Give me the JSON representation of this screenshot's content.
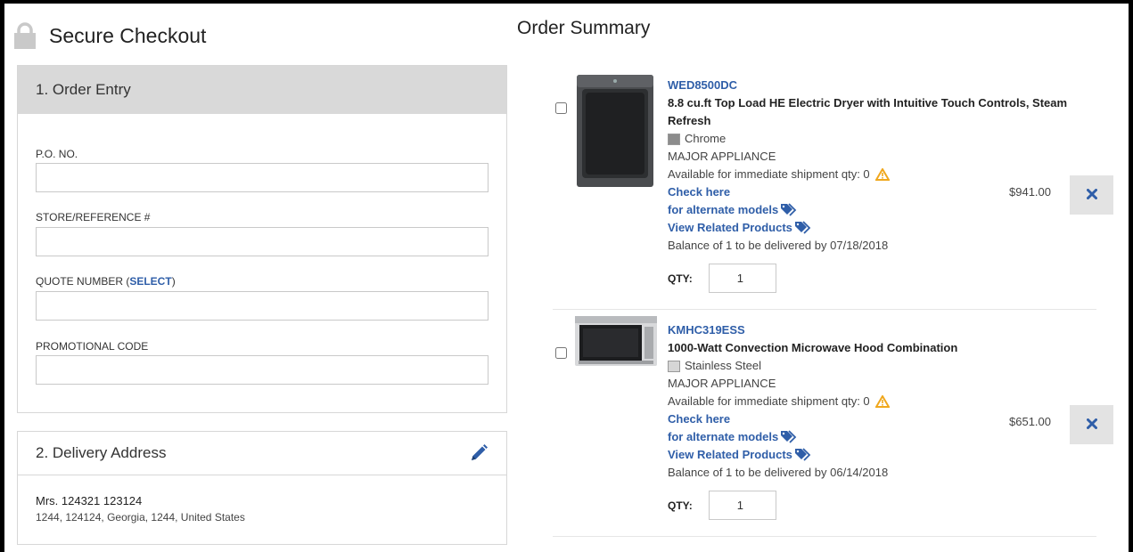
{
  "checkout": {
    "title": "Secure Checkout",
    "icon": "lock-icon"
  },
  "order_entry": {
    "heading": "1. Order Entry",
    "po_label": "P.O. NO.",
    "po_value": "",
    "store_label": "STORE/REFERENCE #",
    "store_value": "",
    "quote_label": "QUOTE NUMBER (",
    "quote_select": "SELECT",
    "quote_close": ")",
    "quote_value": "",
    "promo_label": "PROMOTIONAL CODE",
    "promo_value": ""
  },
  "delivery": {
    "heading": "2. Delivery Address",
    "edit_icon": "pencil-icon",
    "name": "Mrs.  124321  123124",
    "address": "1244,  124124,  Georgia,  1244,  United States"
  },
  "summary": {
    "title": "Order Summary",
    "items": [
      {
        "sku": "WED8500DC",
        "description": "8.8 cu.ft Top Load HE Electric Dryer with Intuitive Touch Controls, Steam Refresh",
        "color": "Chrome",
        "swatch_color": "#8c8c8c",
        "category": "MAJOR APPLIANCE",
        "availability": "Available for immediate shipment qty: 0",
        "check_here": "Check here",
        "alternate": "for alternate models",
        "related": "View Related Products",
        "balance": "Balance of 1 to be delivered by 07/18/2018",
        "qty_label": "QTY:",
        "qty": "1",
        "price": "$941.00"
      },
      {
        "sku": "KMHC319ESS",
        "description": "1000-Watt Convection Microwave Hood Combination",
        "color": "Stainless Steel",
        "swatch_color": "#d6d6d6",
        "category": "MAJOR APPLIANCE",
        "availability": "Available for immediate shipment qty: 0",
        "check_here": "Check here",
        "alternate": "for alternate models",
        "related": "View Related Products",
        "balance": "Balance of 1 to be delivered by 06/14/2018",
        "qty_label": "QTY:",
        "qty": "1",
        "price": "$651.00"
      }
    ]
  },
  "colors": {
    "link": "#2f5ea8",
    "warning": "#f0a81e",
    "panel_header": "#d9d9d9"
  }
}
